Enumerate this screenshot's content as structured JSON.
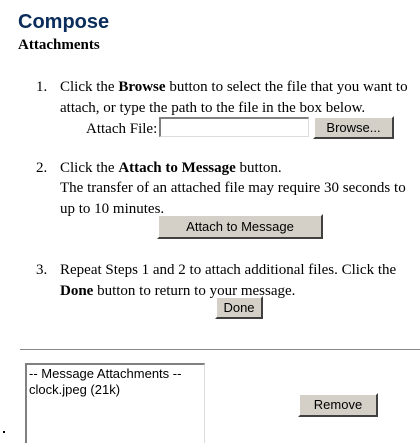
{
  "header": {
    "title": "Compose",
    "subtitle": "Attachments"
  },
  "steps": [
    {
      "number": "1.",
      "text_before": "Click the ",
      "bold": "Browse",
      "text_after": " button to select the file that you want to attach, or type the path to the file in the box below."
    },
    {
      "number": "2.",
      "text_before": "Click the ",
      "bold": "Attach to Message",
      "text_after": " button.",
      "note": "The transfer of an attached file may require 30 seconds to up to 10 minutes."
    },
    {
      "number": "3.",
      "text_before": "Repeat Steps 1 and 2 to attach additional files. Click the ",
      "bold": "Done",
      "text_after": " button to return to your message."
    }
  ],
  "attach_file": {
    "label": "Attach File:",
    "value": "",
    "browse_label": "Browse..."
  },
  "attach_button_label": "Attach to Message",
  "done_button_label": "Done",
  "attachments": {
    "items": [
      "-- Message Attachments --",
      "clock.jpeg (21k)"
    ],
    "remove_label": "Remove"
  }
}
